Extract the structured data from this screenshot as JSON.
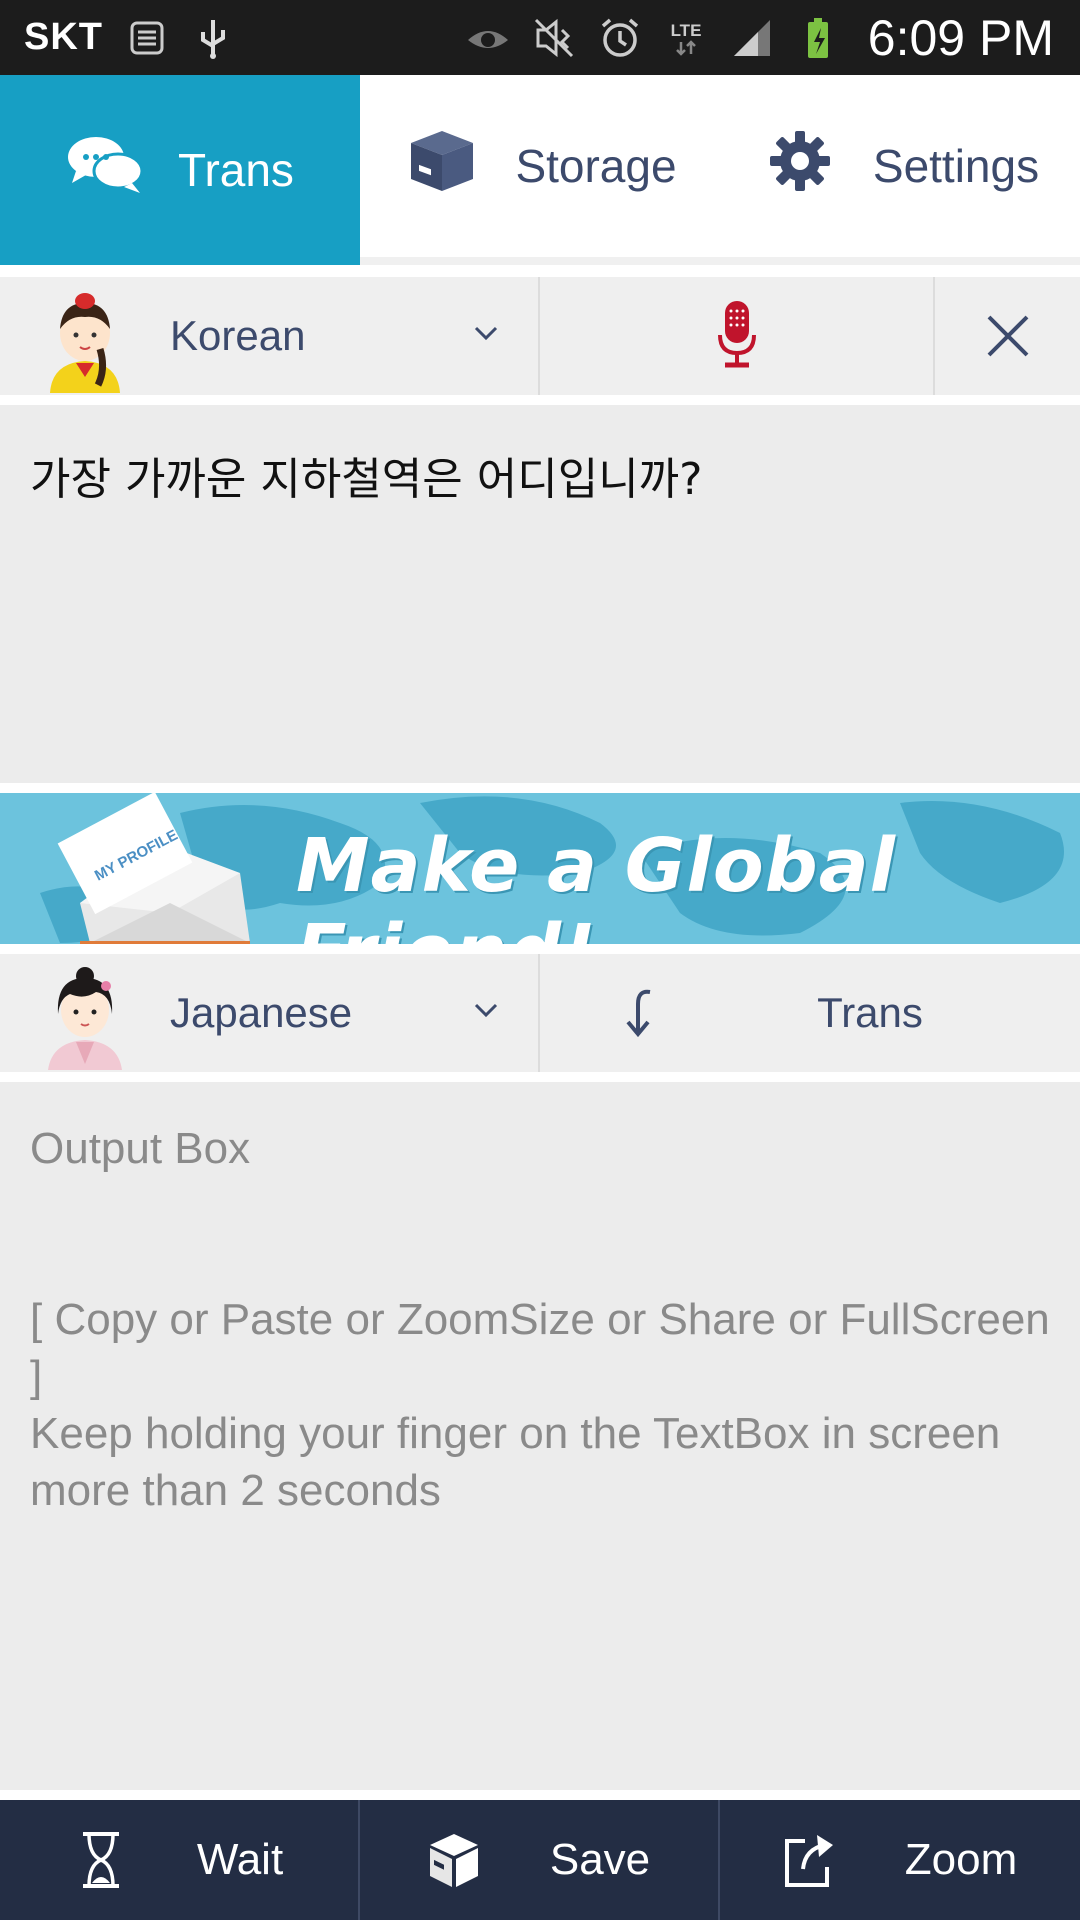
{
  "status_bar": {
    "carrier": "SKT",
    "time": "6:09 PM",
    "battery_color": "#7cc242"
  },
  "tabs": [
    {
      "label": "Trans",
      "icon": "chat-bubbles-icon",
      "active": true
    },
    {
      "label": "Storage",
      "icon": "box-icon",
      "active": false
    },
    {
      "label": "Settings",
      "icon": "gear-icon",
      "active": false
    }
  ],
  "source": {
    "language": "Korean",
    "input_text": "가장 가까운 지하철역은 어디입니까?"
  },
  "banner": {
    "text": "Make a Global Friend!",
    "envelope_label": "MY PROFILE"
  },
  "target": {
    "language": "Japanese",
    "trans_label": "Trans"
  },
  "output": {
    "title": "Output Box",
    "hint_line1": "[ Copy or Paste or ZoomSize or Share or FullScreen ]",
    "hint_line2": "Keep holding your finger on the TextBox in screen more than 2 seconds"
  },
  "bottom_bar": {
    "wait_label": "Wait",
    "save_label": "Save",
    "zoom_label": "Zoom"
  },
  "colors": {
    "accent": "#179fc4",
    "navy": "#3c4a6c",
    "toolbar": "#232d44",
    "mic": "#c0142c"
  }
}
